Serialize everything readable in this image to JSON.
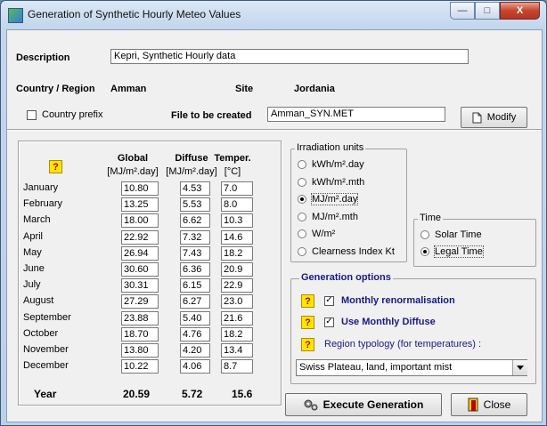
{
  "window": {
    "title": "Generation of Synthetic Hourly Meteo Values",
    "minimize": "—",
    "maximize": "□",
    "close": "X"
  },
  "description": {
    "label": "Description",
    "value": "Kepri, Synthetic Hourly data"
  },
  "location": {
    "country_label": "Country / Region",
    "country_value": "Amman",
    "site_label": "Site",
    "site_value": "Jordania"
  },
  "country_prefix": {
    "label": "Country prefix",
    "checked": false
  },
  "file": {
    "label": "File to be created",
    "value": "Amman_SYN.MET",
    "modify_label": "Modify"
  },
  "help_glyph": "?",
  "table": {
    "headers": [
      {
        "title": "Global",
        "unit": "[MJ/m².day]"
      },
      {
        "title": "Diffuse",
        "unit": "[MJ/m².day]"
      },
      {
        "title": "Temper.",
        "unit": "[°C]"
      }
    ],
    "rows": [
      {
        "month": "January",
        "global": "10.80",
        "diffuse": "4.53",
        "temp": "7.0"
      },
      {
        "month": "February",
        "global": "13.25",
        "diffuse": "5.53",
        "temp": "8.0"
      },
      {
        "month": "March",
        "global": "18.00",
        "diffuse": "6.62",
        "temp": "10.3"
      },
      {
        "month": "April",
        "global": "22.92",
        "diffuse": "7.32",
        "temp": "14.6"
      },
      {
        "month": "May",
        "global": "26.94",
        "diffuse": "7.43",
        "temp": "18.2"
      },
      {
        "month": "June",
        "global": "30.60",
        "diffuse": "6.36",
        "temp": "20.9"
      },
      {
        "month": "July",
        "global": "30.31",
        "diffuse": "6.15",
        "temp": "22.9"
      },
      {
        "month": "August",
        "global": "27.29",
        "diffuse": "6.27",
        "temp": "23.0"
      },
      {
        "month": "September",
        "global": "23.88",
        "diffuse": "5.40",
        "temp": "21.6"
      },
      {
        "month": "October",
        "global": "18.70",
        "diffuse": "4.76",
        "temp": "18.2"
      },
      {
        "month": "November",
        "global": "13.80",
        "diffuse": "4.20",
        "temp": "13.4"
      },
      {
        "month": "December",
        "global": "10.22",
        "diffuse": "4.06",
        "temp": "8.7"
      }
    ],
    "year": {
      "label": "Year",
      "global": "20.59",
      "diffuse": "5.72",
      "temp": "15.6"
    }
  },
  "irradiation_units": {
    "title": "Irradiation units",
    "options": [
      "kWh/m².day",
      "kWh/m².mth",
      "MJ/m².day",
      "MJ/m².mth",
      "W/m²",
      "Clearness Index Kt"
    ],
    "selected": "MJ/m².day"
  },
  "time": {
    "title": "Time",
    "options": [
      "Solar Time",
      "Legal Time"
    ],
    "selected": "Legal Time"
  },
  "generation_options": {
    "title": "Generation options",
    "monthly_renormalisation": {
      "label": "Monthly renormalisation",
      "checked": true
    },
    "use_monthly_diffuse": {
      "label": "Use Monthly Diffuse",
      "checked": true
    },
    "region_label": "Region typology  (for temperatures) :",
    "region_value": "Swiss Plateau, land, important mist"
  },
  "buttons": {
    "execute": "Execute Generation",
    "close": "Close"
  }
}
